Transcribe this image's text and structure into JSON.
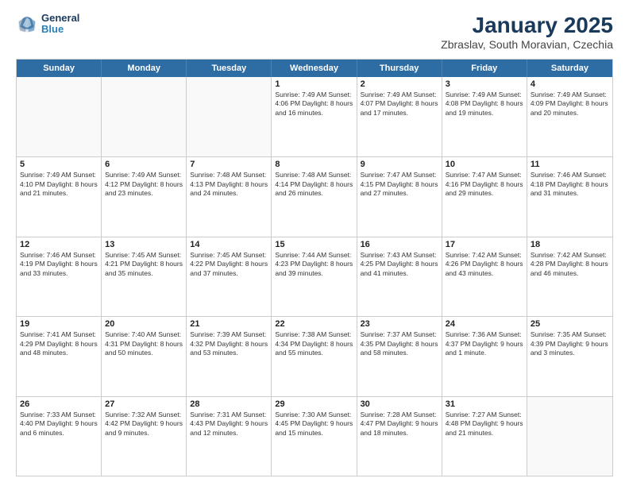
{
  "logo": {
    "line1": "General",
    "line2": "Blue"
  },
  "title": "January 2025",
  "subtitle": "Zbraslav, South Moravian, Czechia",
  "weekdays": [
    "Sunday",
    "Monday",
    "Tuesday",
    "Wednesday",
    "Thursday",
    "Friday",
    "Saturday"
  ],
  "weeks": [
    [
      {
        "day": "",
        "info": "",
        "empty": true
      },
      {
        "day": "",
        "info": "",
        "empty": true
      },
      {
        "day": "",
        "info": "",
        "empty": true
      },
      {
        "day": "1",
        "info": "Sunrise: 7:49 AM\nSunset: 4:06 PM\nDaylight: 8 hours\nand 16 minutes."
      },
      {
        "day": "2",
        "info": "Sunrise: 7:49 AM\nSunset: 4:07 PM\nDaylight: 8 hours\nand 17 minutes."
      },
      {
        "day": "3",
        "info": "Sunrise: 7:49 AM\nSunset: 4:08 PM\nDaylight: 8 hours\nand 19 minutes."
      },
      {
        "day": "4",
        "info": "Sunrise: 7:49 AM\nSunset: 4:09 PM\nDaylight: 8 hours\nand 20 minutes."
      }
    ],
    [
      {
        "day": "5",
        "info": "Sunrise: 7:49 AM\nSunset: 4:10 PM\nDaylight: 8 hours\nand 21 minutes."
      },
      {
        "day": "6",
        "info": "Sunrise: 7:49 AM\nSunset: 4:12 PM\nDaylight: 8 hours\nand 23 minutes."
      },
      {
        "day": "7",
        "info": "Sunrise: 7:48 AM\nSunset: 4:13 PM\nDaylight: 8 hours\nand 24 minutes."
      },
      {
        "day": "8",
        "info": "Sunrise: 7:48 AM\nSunset: 4:14 PM\nDaylight: 8 hours\nand 26 minutes."
      },
      {
        "day": "9",
        "info": "Sunrise: 7:47 AM\nSunset: 4:15 PM\nDaylight: 8 hours\nand 27 minutes."
      },
      {
        "day": "10",
        "info": "Sunrise: 7:47 AM\nSunset: 4:16 PM\nDaylight: 8 hours\nand 29 minutes."
      },
      {
        "day": "11",
        "info": "Sunrise: 7:46 AM\nSunset: 4:18 PM\nDaylight: 8 hours\nand 31 minutes."
      }
    ],
    [
      {
        "day": "12",
        "info": "Sunrise: 7:46 AM\nSunset: 4:19 PM\nDaylight: 8 hours\nand 33 minutes."
      },
      {
        "day": "13",
        "info": "Sunrise: 7:45 AM\nSunset: 4:21 PM\nDaylight: 8 hours\nand 35 minutes."
      },
      {
        "day": "14",
        "info": "Sunrise: 7:45 AM\nSunset: 4:22 PM\nDaylight: 8 hours\nand 37 minutes."
      },
      {
        "day": "15",
        "info": "Sunrise: 7:44 AM\nSunset: 4:23 PM\nDaylight: 8 hours\nand 39 minutes."
      },
      {
        "day": "16",
        "info": "Sunrise: 7:43 AM\nSunset: 4:25 PM\nDaylight: 8 hours\nand 41 minutes."
      },
      {
        "day": "17",
        "info": "Sunrise: 7:42 AM\nSunset: 4:26 PM\nDaylight: 8 hours\nand 43 minutes."
      },
      {
        "day": "18",
        "info": "Sunrise: 7:42 AM\nSunset: 4:28 PM\nDaylight: 8 hours\nand 46 minutes."
      }
    ],
    [
      {
        "day": "19",
        "info": "Sunrise: 7:41 AM\nSunset: 4:29 PM\nDaylight: 8 hours\nand 48 minutes."
      },
      {
        "day": "20",
        "info": "Sunrise: 7:40 AM\nSunset: 4:31 PM\nDaylight: 8 hours\nand 50 minutes."
      },
      {
        "day": "21",
        "info": "Sunrise: 7:39 AM\nSunset: 4:32 PM\nDaylight: 8 hours\nand 53 minutes."
      },
      {
        "day": "22",
        "info": "Sunrise: 7:38 AM\nSunset: 4:34 PM\nDaylight: 8 hours\nand 55 minutes."
      },
      {
        "day": "23",
        "info": "Sunrise: 7:37 AM\nSunset: 4:35 PM\nDaylight: 8 hours\nand 58 minutes."
      },
      {
        "day": "24",
        "info": "Sunrise: 7:36 AM\nSunset: 4:37 PM\nDaylight: 9 hours\nand 1 minute."
      },
      {
        "day": "25",
        "info": "Sunrise: 7:35 AM\nSunset: 4:39 PM\nDaylight: 9 hours\nand 3 minutes."
      }
    ],
    [
      {
        "day": "26",
        "info": "Sunrise: 7:33 AM\nSunset: 4:40 PM\nDaylight: 9 hours\nand 6 minutes."
      },
      {
        "day": "27",
        "info": "Sunrise: 7:32 AM\nSunset: 4:42 PM\nDaylight: 9 hours\nand 9 minutes."
      },
      {
        "day": "28",
        "info": "Sunrise: 7:31 AM\nSunset: 4:43 PM\nDaylight: 9 hours\nand 12 minutes."
      },
      {
        "day": "29",
        "info": "Sunrise: 7:30 AM\nSunset: 4:45 PM\nDaylight: 9 hours\nand 15 minutes."
      },
      {
        "day": "30",
        "info": "Sunrise: 7:28 AM\nSunset: 4:47 PM\nDaylight: 9 hours\nand 18 minutes."
      },
      {
        "day": "31",
        "info": "Sunrise: 7:27 AM\nSunset: 4:48 PM\nDaylight: 9 hours\nand 21 minutes."
      },
      {
        "day": "",
        "info": "",
        "empty": true
      }
    ]
  ]
}
